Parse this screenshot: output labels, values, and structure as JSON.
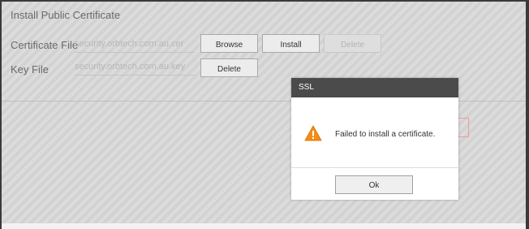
{
  "section": {
    "title": "Install Public Certificate"
  },
  "certificate_row": {
    "label": "Certificate File",
    "file_value": "security.orbtech.com.au.cer",
    "browse_label": "Browse",
    "install_label": "Install",
    "delete_label": "Delete"
  },
  "key_row": {
    "label": "Key File",
    "file_value": "security.orbtech.com.au.key",
    "delete_label": "Delete"
  },
  "dialog": {
    "title": "SSL",
    "icon": "warning-icon",
    "message": "Failed to install a certificate.",
    "ok_label": "Ok"
  },
  "colors": {
    "dialog_header": "#4b4b4b",
    "warning": "#f28c1a",
    "background_stripe": "#d2d2d2"
  }
}
